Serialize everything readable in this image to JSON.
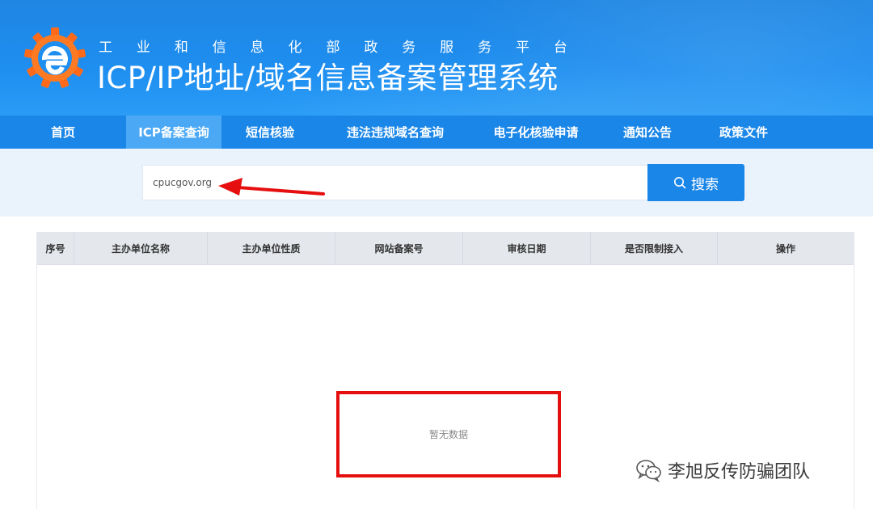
{
  "header": {
    "subtitle_chars": [
      "工",
      "业",
      "和",
      "信",
      "息",
      "化",
      "部",
      "政",
      "务",
      "服",
      "务",
      "平",
      "台"
    ],
    "title": "ICP/IP地址/域名信息备案管理系统"
  },
  "nav": {
    "items": [
      {
        "label": "首页",
        "active": false
      },
      {
        "label": "ICP备案查询",
        "active": true
      },
      {
        "label": "短信核验",
        "active": false
      },
      {
        "label": "违法违规域名查询",
        "active": false
      },
      {
        "label": "电子化核验申请",
        "active": false
      },
      {
        "label": "通知公告",
        "active": false
      },
      {
        "label": "政策文件",
        "active": false
      }
    ]
  },
  "search": {
    "value": "cpucgov.org",
    "button_label": "搜索",
    "button_icon": "search-icon"
  },
  "table": {
    "columns": [
      "序号",
      "主办单位名称",
      "主办单位性质",
      "网站备案号",
      "审核日期",
      "是否限制接入",
      "操作"
    ],
    "rows": [],
    "empty_text": "暂无数据"
  },
  "watermark": {
    "text": "李旭反传防骗团队",
    "icon": "wechat-icon"
  },
  "colors": {
    "banner": "#1e8ef0",
    "nav": "#1a86e8",
    "nav_active": "#4aa8f5",
    "annotation": "#e60f0f"
  }
}
